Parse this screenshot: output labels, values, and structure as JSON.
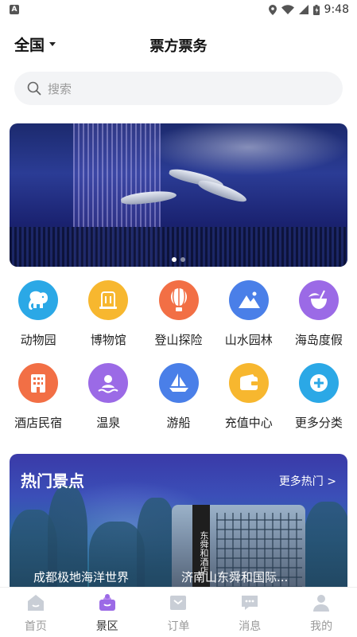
{
  "status_bar": {
    "left_icon": "A",
    "time": "9:48",
    "icons": [
      "location-icon",
      "wifi-icon",
      "signal-icon",
      "battery-icon"
    ]
  },
  "header": {
    "region": "全国",
    "title": "票方票务"
  },
  "search": {
    "placeholder": "搜索"
  },
  "banner": {
    "slides_count": 2,
    "active_slide": 1
  },
  "categories": [
    {
      "label": "动物园",
      "icon": "elephant-icon",
      "color": "#2ba8e6"
    },
    {
      "label": "博物馆",
      "icon": "museum-icon",
      "color": "#f7b72f"
    },
    {
      "label": "登山探险",
      "icon": "balloon-icon",
      "color": "#f26f45"
    },
    {
      "label": "山水园林",
      "icon": "mountain-icon",
      "color": "#4a7fe8"
    },
    {
      "label": "海岛度假",
      "icon": "coconut-icon",
      "color": "#9b6ae6"
    },
    {
      "label": "酒店民宿",
      "icon": "hotel-icon",
      "color": "#f26f45"
    },
    {
      "label": "温泉",
      "icon": "hot-spring-icon",
      "color": "#9b6ae6"
    },
    {
      "label": "游船",
      "icon": "boat-icon",
      "color": "#4a7fe8"
    },
    {
      "label": "充值中心",
      "icon": "wallet-icon",
      "color": "#f7b72f"
    },
    {
      "label": "更多分类",
      "icon": "plus-icon",
      "color": "#2ba8e6"
    }
  ],
  "hot": {
    "title": "热门景点",
    "more": "更多热门 >",
    "items": [
      {
        "name": "成都极地海洋世界"
      },
      {
        "name": "济南山东舜和国际..."
      }
    ],
    "sign_text": "东舜和酒店"
  },
  "bottom_nav": [
    {
      "label": "首页",
      "icon": "home-icon",
      "active": false
    },
    {
      "label": "景区",
      "icon": "scenic-icon",
      "active": true
    },
    {
      "label": "订单",
      "icon": "order-icon",
      "active": false
    },
    {
      "label": "消息",
      "icon": "message-icon",
      "active": false
    },
    {
      "label": "我的",
      "icon": "profile-icon",
      "active": false
    }
  ],
  "colors": {
    "accent_purple": "#9b6ae6",
    "nav_inactive": "#c9ced6"
  }
}
